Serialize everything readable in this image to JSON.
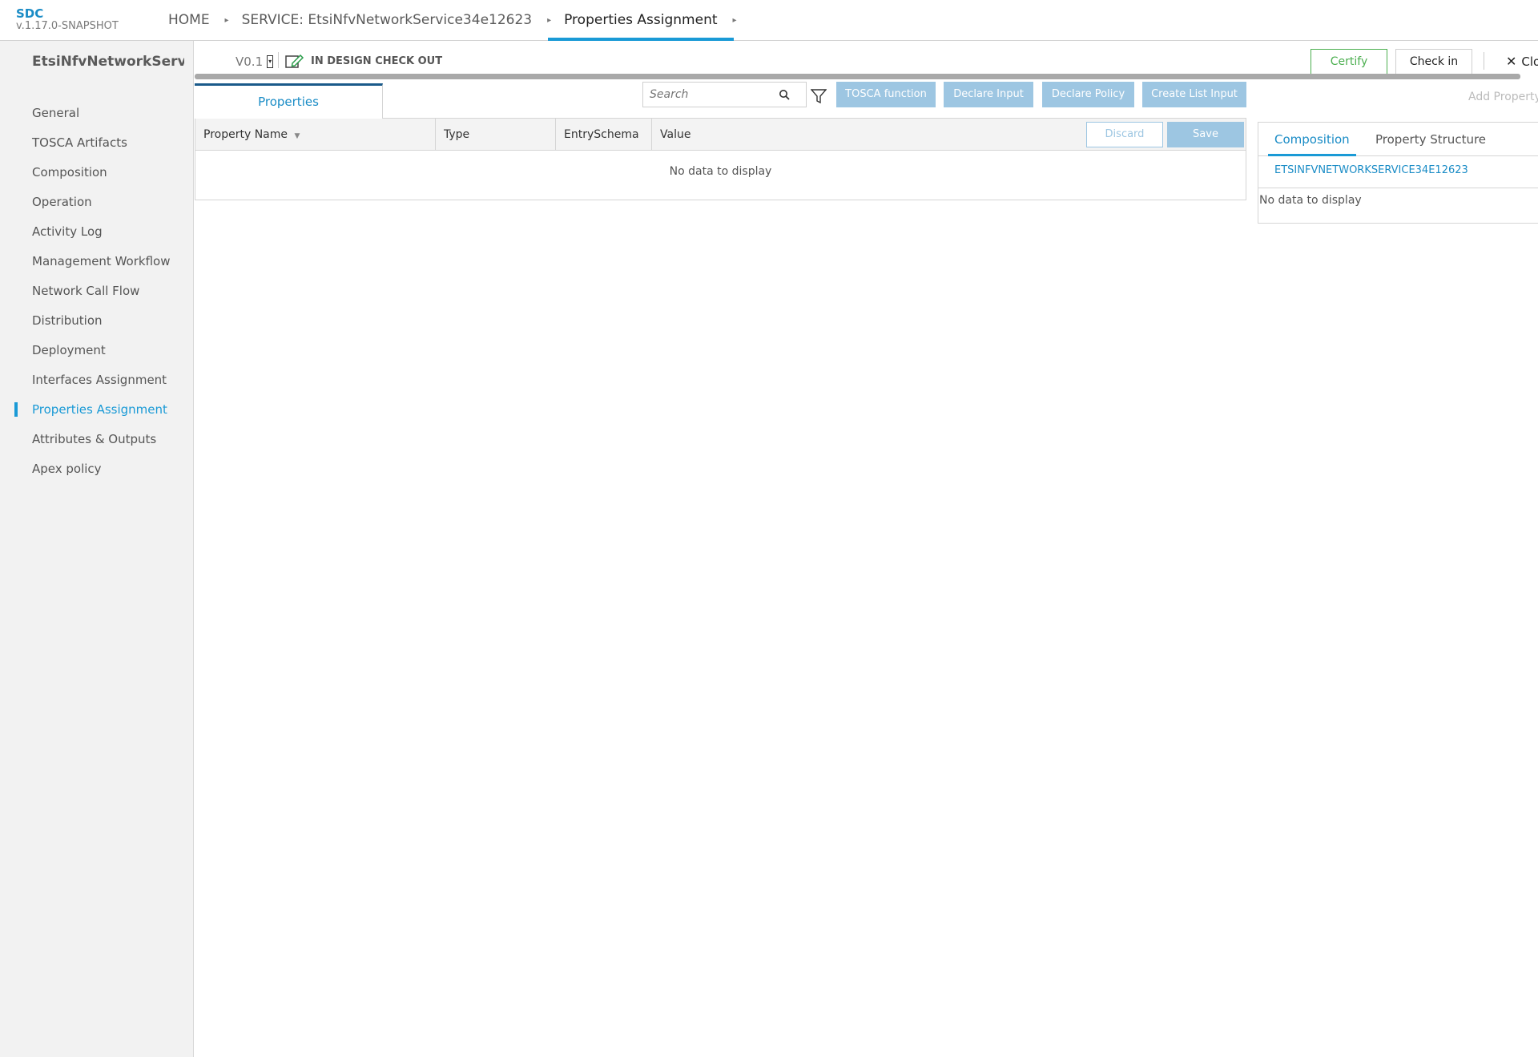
{
  "app": {
    "name": "SDC",
    "version": "v.1.17.0-SNAPSHOT"
  },
  "breadcrumbs": [
    {
      "label": "HOME"
    },
    {
      "label": "SERVICE: EtsiNfvNetworkService34e12623"
    },
    {
      "label": "Properties Assignment"
    }
  ],
  "sidebar": {
    "service_name": "EtsiNfvNetworkServic...",
    "items": [
      {
        "label": "General"
      },
      {
        "label": "TOSCA Artifacts"
      },
      {
        "label": "Composition"
      },
      {
        "label": "Operation"
      },
      {
        "label": "Activity Log"
      },
      {
        "label": "Management Workflow"
      },
      {
        "label": "Network Call Flow"
      },
      {
        "label": "Distribution"
      },
      {
        "label": "Deployment"
      },
      {
        "label": "Interfaces Assignment"
      },
      {
        "label": "Properties Assignment"
      },
      {
        "label": "Attributes & Outputs"
      },
      {
        "label": "Apex policy"
      }
    ],
    "active_index": 10
  },
  "header": {
    "version": "V0.1",
    "status": "IN DESIGN CHECK OUT",
    "certify_label": "Certify",
    "checkin_label": "Check in",
    "close_label": "Clo"
  },
  "tabs": {
    "properties": "Properties"
  },
  "toolbar": {
    "search_placeholder": "Search",
    "tosca_function": "TOSCA function",
    "declare_input": "Declare Input",
    "declare_policy": "Declare Policy",
    "create_list_input": "Create List Input",
    "add_property": "Add Property"
  },
  "table": {
    "columns": [
      "Property Name",
      "Type",
      "EntrySchema",
      "Value"
    ],
    "discard_label": "Discard",
    "save_label": "Save",
    "empty_text": "No data to display"
  },
  "right_panel": {
    "tabs": [
      "Composition",
      "Property Structure"
    ],
    "node_name": "ETSINFVNETWORKSERVICE34E12623",
    "empty_text": "No data to display"
  },
  "colors": {
    "accent": "#1a9ad6",
    "certify": "#4caf50",
    "disabled_button": "#9dc6e2"
  }
}
